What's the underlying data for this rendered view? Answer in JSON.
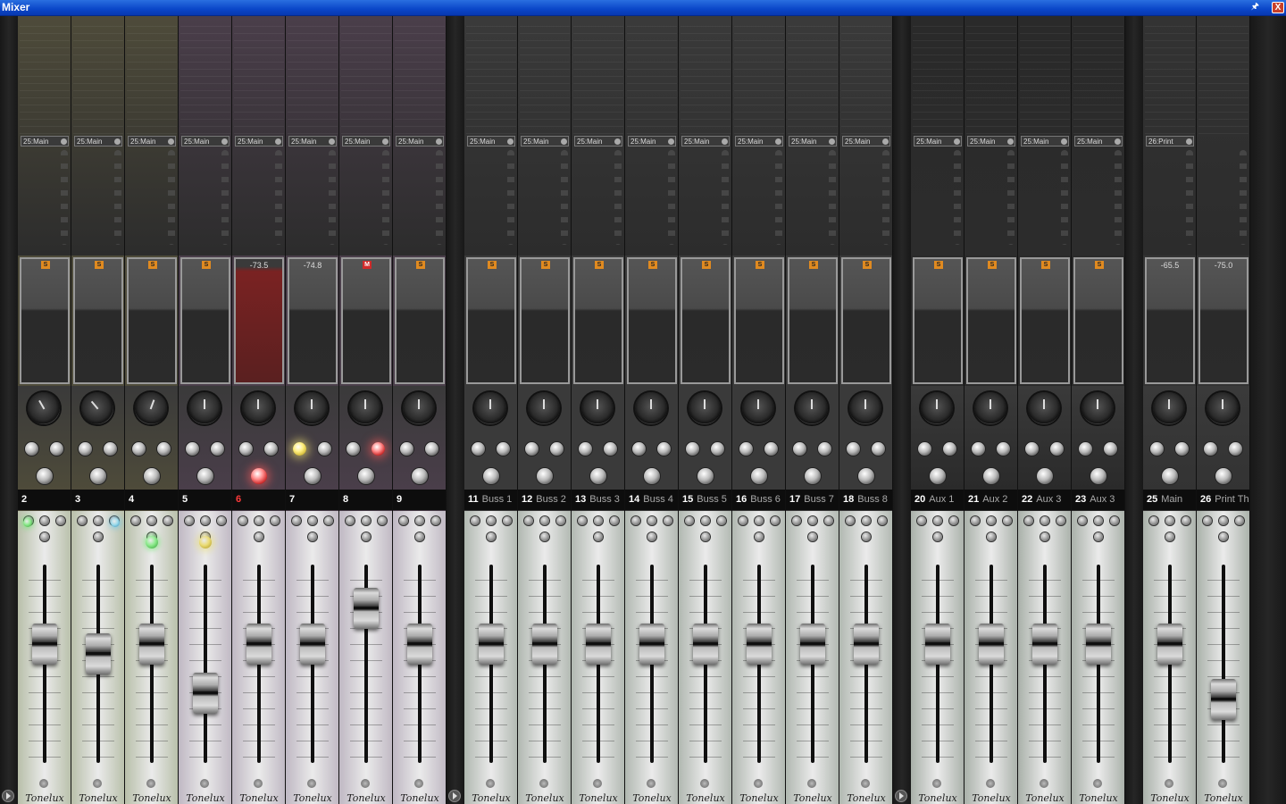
{
  "window": {
    "title": "Mixer",
    "pin_icon": "pin-icon",
    "close_icon": "close-icon",
    "close_label": "X"
  },
  "strips": [
    {
      "num": "2",
      "name": "",
      "route": "25:Main",
      "meter_label": "",
      "badge": "S",
      "tint": "#4e4b3a",
      "fader_tint": "#c8d0b8",
      "fader": 0.6,
      "knob": -30,
      "led": "green",
      "led_pos": "left",
      "mute_on": false,
      "solo_on": false,
      "num_color": "white"
    },
    {
      "num": "3",
      "name": "",
      "route": "25:Main",
      "meter_label": "",
      "badge": "S",
      "tint": "#4e4b3a",
      "fader_tint": "#c8d0b8",
      "fader": 0.55,
      "knob": -40,
      "led": "cyan",
      "led_pos": "right",
      "mute_on": false,
      "solo_on": false,
      "num_color": "white"
    },
    {
      "num": "4",
      "name": "",
      "route": "25:Main",
      "meter_label": "",
      "badge": "S",
      "tint": "#4e4b3a",
      "fader_tint": "#c8d0b8",
      "fader": 0.6,
      "knob": 20,
      "led": "green-big",
      "led_pos": "center",
      "mute_on": false,
      "solo_on": false,
      "num_color": "white"
    },
    {
      "num": "5",
      "name": "",
      "route": "25:Main",
      "meter_label": "",
      "badge": "S",
      "tint": "#4a3e4a",
      "fader_tint": "#d0c8d4",
      "fader": 0.35,
      "knob": 0,
      "led": "yellow",
      "led_pos": "center",
      "mute_on": false,
      "solo_on": false,
      "num_color": "white"
    },
    {
      "num": "6",
      "name": "",
      "route": "25:Main",
      "meter_label": "-73.5",
      "badge": "",
      "tint": "#4a3e4a",
      "fader_tint": "#d0c8d4",
      "fader": 0.6,
      "knob": 0,
      "led": "",
      "led_pos": "",
      "mute_on": false,
      "solo_on": true,
      "num_color": "red",
      "meter_red": true
    },
    {
      "num": "7",
      "name": "",
      "route": "25:Main",
      "meter_label": "-74.8",
      "badge": "",
      "tint": "#4a3e4a",
      "fader_tint": "#d0c8d4",
      "fader": 0.6,
      "knob": 0,
      "led": "",
      "led_pos": "",
      "mute_on": true,
      "solo_on": false,
      "num_color": "white"
    },
    {
      "num": "8",
      "name": "",
      "route": "25:Main",
      "meter_label": "",
      "badge": "M",
      "tint": "#4a3e4a",
      "fader_tint": "#d0c8d4",
      "fader": 0.78,
      "knob": 0,
      "led": "",
      "led_pos": "",
      "mute_on": false,
      "solo_on": false,
      "num_color": "white",
      "mute2_on": true
    },
    {
      "num": "9",
      "name": "",
      "route": "25:Main",
      "meter_label": "",
      "badge": "S",
      "tint": "#4a3e4a",
      "fader_tint": "#d0c8d4",
      "fader": 0.6,
      "knob": 0,
      "led": "",
      "led_pos": "",
      "mute_on": false,
      "solo_on": false,
      "num_color": "white"
    },
    {
      "num": "11",
      "name": "Buss 1",
      "route": "25:Main",
      "meter_label": "",
      "badge": "S",
      "tint": "#3a3a3a",
      "fader_tint": "#c0c8c0",
      "fader": 0.6,
      "knob": 0,
      "led": "",
      "led_pos": "",
      "num_color": "white"
    },
    {
      "num": "12",
      "name": "Buss 2",
      "route": "25:Main",
      "meter_label": "",
      "badge": "S",
      "tint": "#3a3a3a",
      "fader_tint": "#c0c8c0",
      "fader": 0.6,
      "knob": 0,
      "led": "",
      "led_pos": "",
      "num_color": "white"
    },
    {
      "num": "13",
      "name": "Buss 3",
      "route": "25:Main",
      "meter_label": "",
      "badge": "S",
      "tint": "#3a3a3a",
      "fader_tint": "#c0c8c0",
      "fader": 0.6,
      "knob": 0,
      "led": "",
      "led_pos": "",
      "num_color": "white"
    },
    {
      "num": "14",
      "name": "Buss 4",
      "route": "25:Main",
      "meter_label": "",
      "badge": "S",
      "tint": "#3a3a3a",
      "fader_tint": "#c0c8c0",
      "fader": 0.6,
      "knob": 0,
      "led": "",
      "led_pos": "",
      "num_color": "white"
    },
    {
      "num": "15",
      "name": "Buss 5",
      "route": "25:Main",
      "meter_label": "",
      "badge": "S",
      "tint": "#3a3a3a",
      "fader_tint": "#c0c8c0",
      "fader": 0.6,
      "knob": 0,
      "led": "",
      "led_pos": "",
      "num_color": "white"
    },
    {
      "num": "16",
      "name": "Buss 6",
      "route": "25:Main",
      "meter_label": "",
      "badge": "S",
      "tint": "#3a3a3a",
      "fader_tint": "#c0c8c0",
      "fader": 0.6,
      "knob": 0,
      "led": "",
      "led_pos": "",
      "num_color": "white"
    },
    {
      "num": "17",
      "name": "Buss 7",
      "route": "25:Main",
      "meter_label": "",
      "badge": "S",
      "tint": "#3a3a3a",
      "fader_tint": "#c0c8c0",
      "fader": 0.6,
      "knob": 0,
      "led": "",
      "led_pos": "",
      "num_color": "white"
    },
    {
      "num": "18",
      "name": "Buss 8",
      "route": "25:Main",
      "meter_label": "",
      "badge": "S",
      "tint": "#3a3a3a",
      "fader_tint": "#c0c8c0",
      "fader": 0.6,
      "knob": 0,
      "led": "",
      "led_pos": "",
      "num_color": "white"
    },
    {
      "num": "20",
      "name": "Aux 1",
      "route": "25:Main",
      "meter_label": "",
      "badge": "S",
      "tint": "#2a2a2a",
      "fader_tint": "#b8c0b8",
      "fader": 0.6,
      "knob": 0,
      "led": "",
      "led_pos": "",
      "num_color": "white"
    },
    {
      "num": "21",
      "name": "Aux 2",
      "route": "25:Main",
      "meter_label": "",
      "badge": "S",
      "tint": "#2a2a2a",
      "fader_tint": "#b8c0b8",
      "fader": 0.6,
      "knob": 0,
      "led": "",
      "led_pos": "",
      "num_color": "white"
    },
    {
      "num": "22",
      "name": "Aux 3",
      "route": "25:Main",
      "meter_label": "",
      "badge": "S",
      "tint": "#2a2a2a",
      "fader_tint": "#b8c0b8",
      "fader": 0.6,
      "knob": 0,
      "led": "",
      "led_pos": "",
      "num_color": "white"
    },
    {
      "num": "23",
      "name": "Aux 3",
      "route": "25:Main",
      "meter_label": "",
      "badge": "S",
      "tint": "#2a2a2a",
      "fader_tint": "#b8c0b8",
      "fader": 0.6,
      "knob": 0,
      "led": "",
      "led_pos": "",
      "num_color": "white"
    },
    {
      "num": "25",
      "name": "Main",
      "route": "26:Print",
      "meter_label": "-65.5",
      "badge": "",
      "tint": "#333333",
      "fader_tint": "#b8c0b8",
      "fader": 0.6,
      "knob": 0,
      "led": "",
      "led_pos": "",
      "num_color": "white"
    },
    {
      "num": "26",
      "name": "Print Th",
      "route": "",
      "meter_label": "-75.0",
      "badge": "",
      "tint": "#333333",
      "fader_tint": "#b8c0b8",
      "fader": 0.32,
      "knob": 0,
      "led": "",
      "led_pos": "",
      "num_color": "white"
    }
  ],
  "branding": {
    "logo": "Tonelux"
  },
  "icons": {
    "play": "play-icon"
  }
}
